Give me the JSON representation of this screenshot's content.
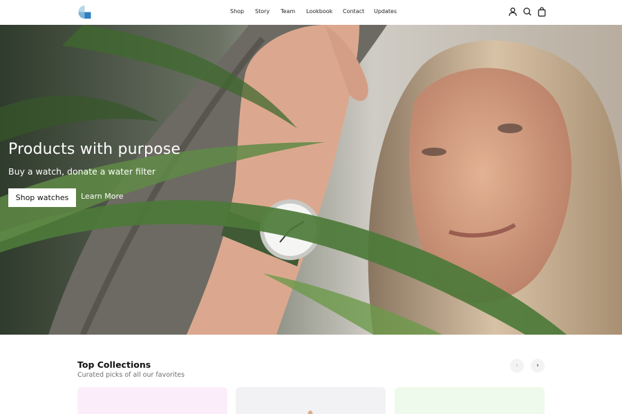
{
  "header": {
    "logo": "brand-logo",
    "nav": [
      {
        "label": "Shop"
      },
      {
        "label": "Story"
      },
      {
        "label": "Team"
      },
      {
        "label": "Lookbook"
      },
      {
        "label": "Contact"
      },
      {
        "label": "Updates"
      }
    ],
    "icons": [
      "account-icon",
      "search-icon",
      "bag-icon"
    ]
  },
  "hero": {
    "title": "Products with purpose",
    "subtitle": "Buy a watch, donate a water filter",
    "primary_button": "Shop watches",
    "secondary_link": "Learn More"
  },
  "collections": {
    "title": "Top Collections",
    "subtitle": "Curated picks of all our favorites",
    "prev_icon": "chevron-left-icon",
    "next_icon": "chevron-right-icon",
    "cards": [
      {
        "color": "#fbeefa"
      },
      {
        "color": "#f2f2f4"
      },
      {
        "color": "#eefaec"
      }
    ]
  },
  "colors": {
    "logo_light": "#b6d6ea",
    "logo_dark": "#2f7fc0",
    "hero_text": "#ffffff",
    "leaf_green": "#4d7a3a"
  }
}
